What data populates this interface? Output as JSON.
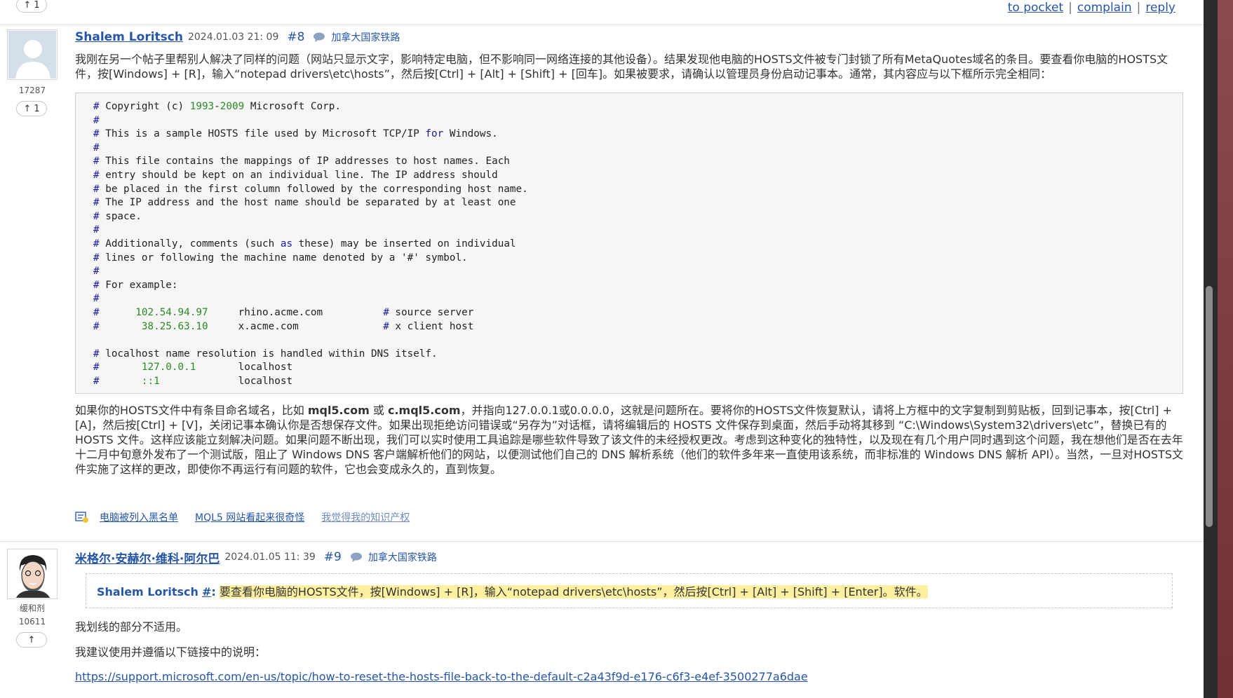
{
  "top_actions": {
    "vote_count": "1",
    "to_pocket": "to pocket",
    "complain": "complain",
    "reply": "reply",
    "sep": "|"
  },
  "post8": {
    "author": "Shalem Loritsch",
    "date": "2024.01.03 21: 09",
    "num": "#8",
    "lang": "加拿大国家铁路",
    "rating": "17287",
    "vote_count": "1",
    "p1": "我刚在另一个帖子里帮别人解决了同样的问题（网站只显示文字，影响特定电脑，但不影响同一网络连接的其他设备）。结果发现他电脑的HOSTS文件被专门封锁了所有MetaQuotes域名的条目。要查看你电脑的HOSTS文件，按[Windows] + [R]，输入“notepad drivers\\etc\\hosts”，然后按[Ctrl] + [Alt] + [Shift] + [回车]。如果被要求，请确认以管理员身份启动记事本。通常，其内容应与以下框所示完全相同：",
    "p2_a": "如果你的HOSTS文件中有条目命名域名，比如 ",
    "p2_b": "mql5.com",
    "p2_c": " 或 ",
    "p2_d": "c.mql5.com",
    "p2_e": "，并指向127.0.0.1或0.0.0.0，这就是问题所在。要将你的HOSTS文件恢复默认，请将上方框中的文字复制到剪贴板，回到记事本，按[Ctrl] + [A]，然后按[Ctrl] + [V]，关闭记事本确认你是否想保存文件。如果出现拒绝访问错误或“另存为”对话框，请将编辑后的 HOSTS 文件保存到桌面，然后手动将其移到 “C:\\Windows\\System32\\drivers\\etc”，替换已有的 HOSTS 文件。这样应该能立刻解决问题。如果问题不断出现，我们可以实时使用工具追踪是哪些软件导致了该文件的未经授权更改。考虑到这种变化的独特性，以及现在有几个用户同时遇到这个问题，我在想他们是否在去年十二月中旬意外发布了一个测试版，阻止了 Windows DNS 客户端解析他们的网站，以便测试他们自己的 DNS 解析系统（他们的软件多年来一直使用该系统，而非标准的 Windows DNS 解析 API）。当然，一旦对HOSTS文件实施了这样的更改，即使你不再运行有问题的软件，它也会变成永久的，直到恢复。",
    "code": {
      "l1": [
        "#",
        " Copyright (c) ",
        "1993",
        "-",
        "2009",
        " Microsoft Corp."
      ],
      "l3": [
        "#",
        " This is a sample HOSTS file used by Microsoft TCP/IP ",
        "for",
        " Windows."
      ],
      "l5": "This file contains the mappings of IP addresses to host names. Each",
      "l6": "entry should be kept on an individual line. The IP address should",
      "l7": "be placed in the first column followed by the corresponding host name.",
      "l8": "The IP address and the host name should be separated by at least one",
      "l9": "space.",
      "l11a": "Additionally, comments (such ",
      "l11b": "as",
      "l11c": " these) may be inserted on individual",
      "l12": "lines or following the machine name denoted by a '#' symbol.",
      "l14": "For example:",
      "ex1_ip": "102.54.94.97",
      "ex1_host": "rhino.acme.com",
      "ex1_comment": "source server",
      "ex2_ip": "38.25.63.10",
      "ex2_host": "x.acme.com",
      "ex2_comment": "x client host",
      "l19": "localhost name resolution is handled within DNS itself.",
      "lh1_ip": "127.0.0.1",
      "lh1_host": "localhost",
      "lh2_ip": "::1",
      "lh2_host": "localhost",
      "hash": "#"
    }
  },
  "related": {
    "items": [
      "电脑被列入黑名单",
      "MQL5 网站看起来很奇怪",
      "我觉得我的知识产权"
    ]
  },
  "post9": {
    "author": "米格尔·安赫尔·维科·阿尔巴",
    "date": "2024.01.05 11: 39",
    "num": "#9",
    "lang": "加拿大国家铁路",
    "role": "缓和剂",
    "rating": "10611",
    "quote_author": "Shalem Loritsch",
    "quote_hash": "#",
    "quote_colon": ":",
    "quote_text": "要查看你电脑的HOSTS文件，按[Windows] + [R]，输入“notepad drivers\\etc\\hosts”，然后按[Ctrl] + [Alt] + [Shift] + [Enter]。软件。",
    "p1": "我划线的部分不适用。",
    "p2": "我建议使用并遵循以下链接中的说明：",
    "url": "https://support.microsoft.com/en-us/topic/how-to-reset-the-hosts-file-back-to-the-default-c2a43f9d-e176-c6f3-e4ef-3500277a6dae"
  }
}
